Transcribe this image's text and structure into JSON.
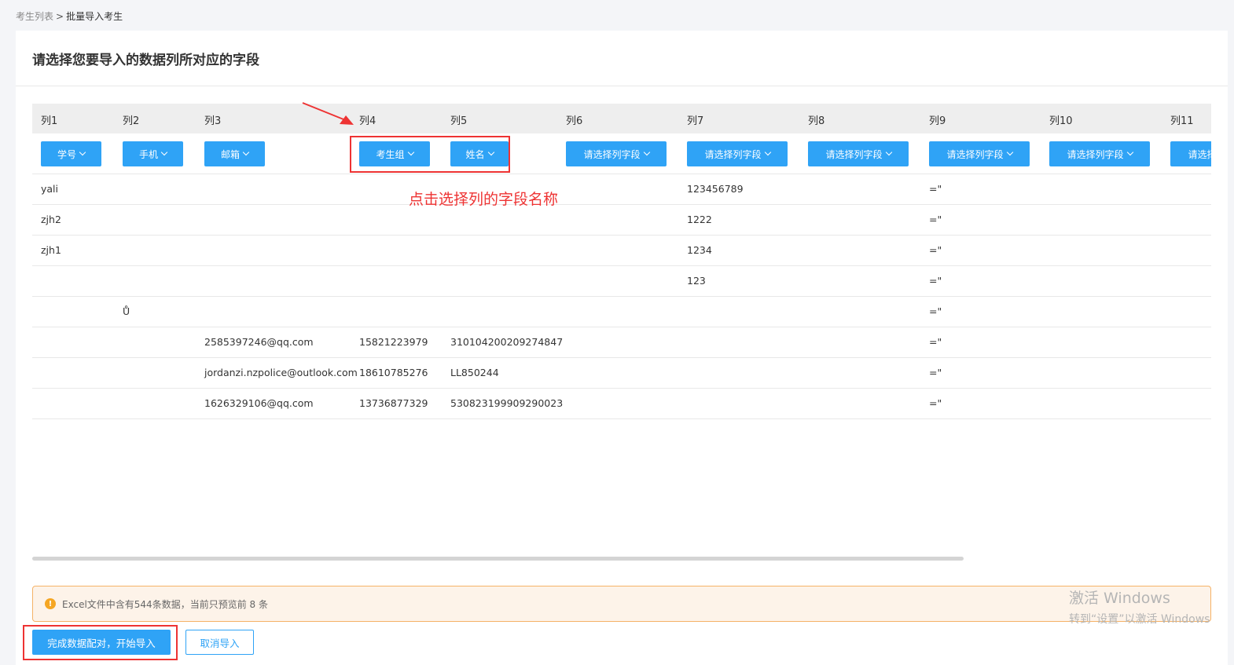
{
  "breadcrumb": {
    "parent": "考生列表",
    "separator": ">",
    "current": "批量导入考生"
  },
  "page_title": "请选择您要导入的数据列所对应的字段",
  "columns": [
    {
      "label": "列1",
      "field": "学号"
    },
    {
      "label": "列2",
      "field": "手机"
    },
    {
      "label": "列3",
      "field": "邮箱"
    },
    {
      "label": "列4",
      "field": "考生组"
    },
    {
      "label": "列5",
      "field": "姓名"
    },
    {
      "label": "列6",
      "field": "请选择列字段"
    },
    {
      "label": "列7",
      "field": "请选择列字段"
    },
    {
      "label": "列8",
      "field": "请选择列字段"
    },
    {
      "label": "列9",
      "field": "请选择列字段"
    },
    {
      "label": "列10",
      "field": "请选择列字段"
    },
    {
      "label": "列11",
      "field": "请选择列字段"
    }
  ],
  "rows": [
    [
      "yali",
      "",
      "",
      "",
      "",
      "",
      "123456789",
      "",
      "=\"",
      "",
      ""
    ],
    [
      "zjh2",
      "",
      "",
      "",
      "",
      "",
      "1222",
      "",
      "=\"",
      "",
      ""
    ],
    [
      "zjh1",
      "",
      "",
      "",
      "",
      "",
      "1234",
      "",
      "=\"",
      "",
      ""
    ],
    [
      "",
      "",
      "",
      "",
      "",
      "",
      "123",
      "",
      "=\"",
      "",
      ""
    ],
    [
      "",
      "Ů",
      "",
      "",
      "",
      "",
      "",
      "",
      "=\"",
      "",
      ""
    ],
    [
      "",
      "",
      "2585397246@qq.com",
      "15821223979",
      "310104200209274847",
      "",
      "",
      "",
      "=\"",
      "",
      ""
    ],
    [
      "",
      "",
      "jordanzi.nzpolice@outlook.com",
      "18610785276",
      "LL850244",
      "",
      "",
      "",
      "=\"",
      "",
      ""
    ],
    [
      "",
      "",
      "1626329106@qq.com",
      "13736877329",
      "530823199909290023",
      "",
      "",
      "",
      "=\"",
      "",
      ""
    ]
  ],
  "annotation": {
    "text": "点击选择列的字段名称",
    "color": "#ee3333"
  },
  "alert": {
    "icon": "warning-icon",
    "text": "Excel文件中含有544条数据，当前只预览前 8 条"
  },
  "actions": {
    "confirm_label": "完成数据配对，开始导入",
    "cancel_label": "取消导入"
  },
  "watermark": {
    "line1": "激活 Windows",
    "line2": "转到“设置”以激活 Windows"
  },
  "colors": {
    "primary": "#2fa3f6",
    "alert_bg": "#fdf3e9",
    "alert_border": "#f5b267",
    "annotation": "#ee3333"
  }
}
